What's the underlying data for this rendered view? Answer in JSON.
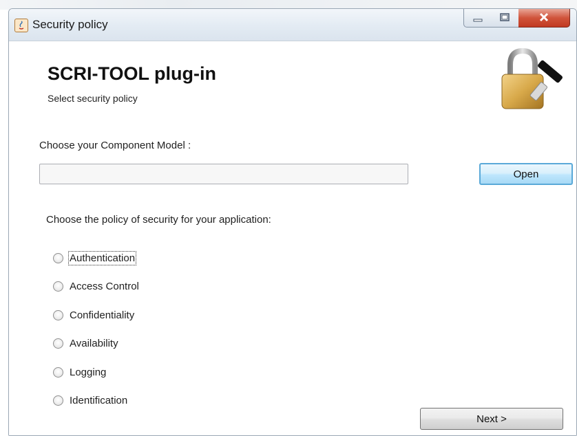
{
  "window": {
    "title": "Security policy",
    "icons": {
      "app": "java-app-icon",
      "minimize": "minimize-icon",
      "maximize": "maximize-icon",
      "close": "close-icon"
    }
  },
  "header": {
    "title": "SCRI-TOOL plug-in",
    "subtitle": "Select security policy",
    "icon": "padlock-key-icon"
  },
  "component_model": {
    "label": "Choose your Component Model :",
    "value": "",
    "open_button": "Open"
  },
  "policy": {
    "label": "Choose the policy of security for your application:",
    "options": [
      {
        "label": "Authentication",
        "selected": false
      },
      {
        "label": "Access Control",
        "selected": false
      },
      {
        "label": "Confidentiality",
        "selected": false
      },
      {
        "label": "Availability",
        "selected": false
      },
      {
        "label": "Logging",
        "selected": false
      },
      {
        "label": "Identification",
        "selected": false
      }
    ]
  },
  "footer": {
    "next_button": "Next >"
  },
  "colors": {
    "close_button": "#c13a22",
    "open_button_border": "#5aa9d8",
    "title_bar": "#e3ebf3"
  }
}
